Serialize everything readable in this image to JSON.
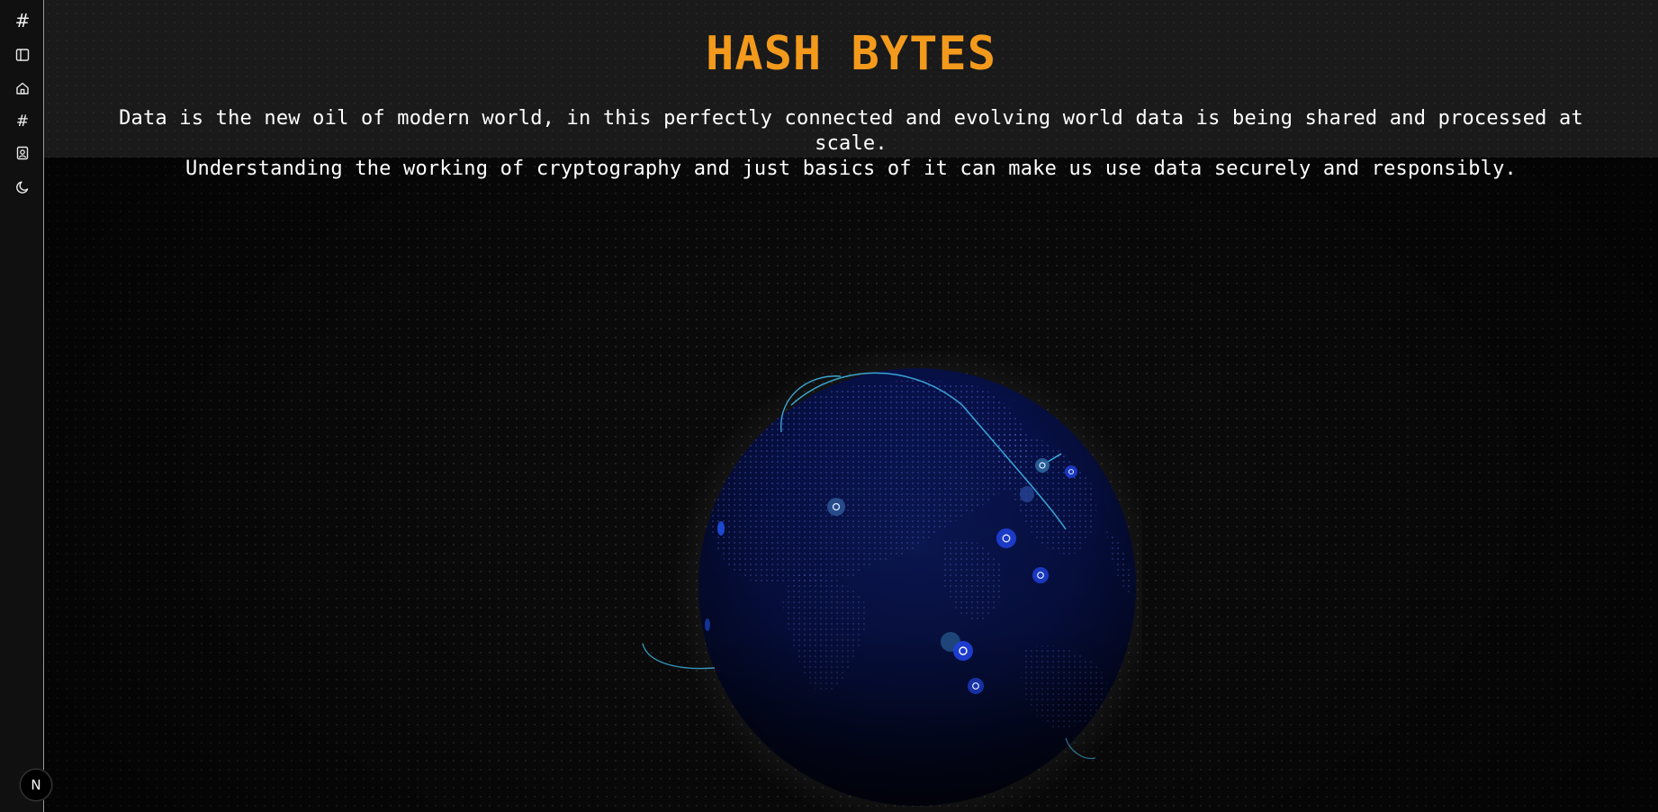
{
  "sidebar": {
    "items": [
      {
        "name": "hash-logo-icon",
        "glyph": "#"
      },
      {
        "name": "sidebar-toggle-icon"
      },
      {
        "name": "home-icon"
      },
      {
        "name": "hash-nav-icon",
        "glyph": "#"
      },
      {
        "name": "contact-card-icon"
      },
      {
        "name": "dark-mode-moon-icon"
      }
    ],
    "badge": "N"
  },
  "hero": {
    "title": "HASH BYTES",
    "line1": "Data is the new oil of modern world, in this perfectly connected and evolving world data is being shared and processed at scale.",
    "line2": "Understanding the working of cryptography and just basics of it can make us use data securely and responsibly."
  },
  "colors": {
    "accent": "#f39a1c",
    "globe": "#0a1450",
    "arc": "#3fb6e8",
    "marker": "#1f3fd6"
  }
}
